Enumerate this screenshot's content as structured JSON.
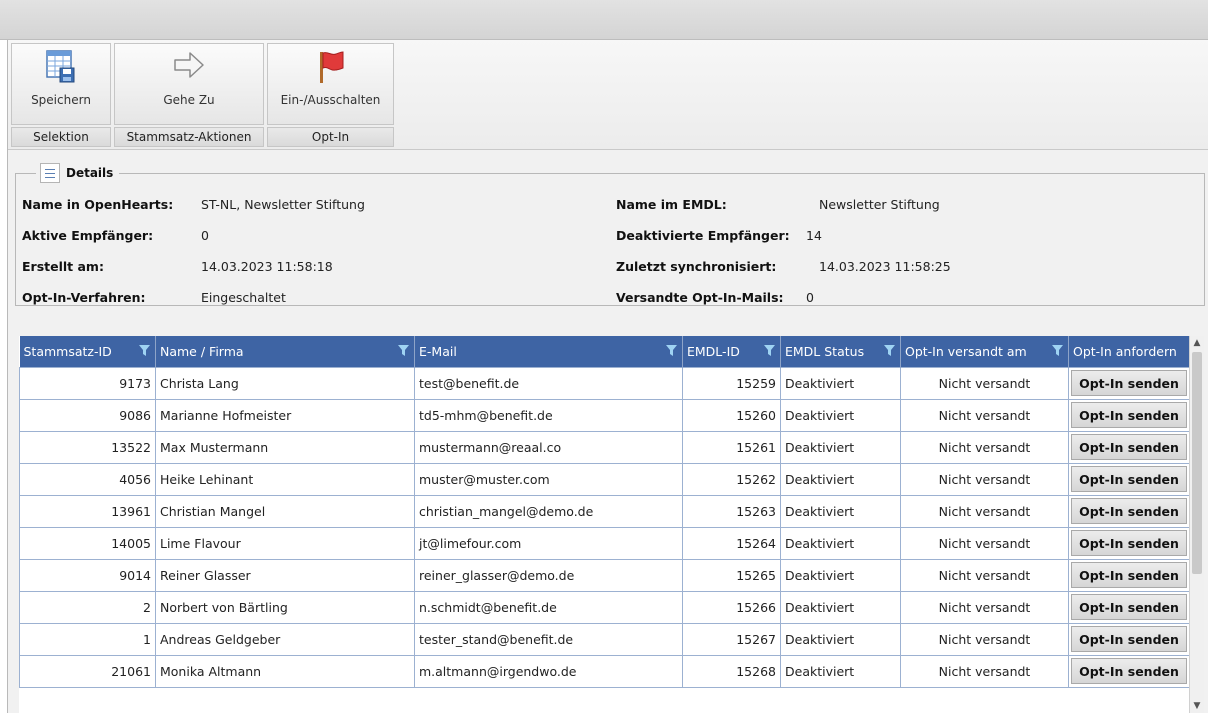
{
  "ribbon": {
    "buttons": [
      {
        "label": "Speichern",
        "icon": "table-save-icon"
      },
      {
        "label": "Gehe Zu",
        "icon": "arrow-right-icon"
      },
      {
        "label": "Ein-/Ausschalten",
        "icon": "red-flag-icon"
      }
    ],
    "groups": [
      "Selektion",
      "Stammsatz-Aktionen",
      "Opt-In"
    ]
  },
  "details": {
    "legend": "Details",
    "left": [
      {
        "label": "Name in OpenHearts:",
        "value": "ST-NL, Newsletter Stiftung"
      },
      {
        "label": "Aktive Empfänger:",
        "value": "0"
      },
      {
        "label": "Erstellt am:",
        "value": "14.03.2023 11:58:18"
      },
      {
        "label": "Opt-In-Verfahren:",
        "value": "Eingeschaltet"
      }
    ],
    "right": [
      {
        "label": "Name im EMDL:",
        "value": "Newsletter Stiftung"
      },
      {
        "label": "Deaktivierte Empfänger:",
        "value": "14"
      },
      {
        "label": "Zuletzt synchronisiert:",
        "value": "14.03.2023 11:58:25"
      },
      {
        "label": "Versandte Opt-In-Mails:",
        "value": "0"
      }
    ]
  },
  "grid": {
    "columns": [
      "Stammsatz-ID",
      "Name / Firma",
      "E-Mail",
      "EMDL-ID",
      "EMDL Status",
      "Opt-In versandt am",
      "Opt-In anfordern"
    ],
    "button_label": "Opt-In senden",
    "rows": [
      {
        "id": "9173",
        "name": "Christa Lang",
        "email": "test@benefit.de",
        "emdl": "15259",
        "status": "Deaktiviert",
        "sent": "Nicht versandt"
      },
      {
        "id": "9086",
        "name": "Marianne Hofmeister",
        "email": "td5-mhm@benefit.de",
        "emdl": "15260",
        "status": "Deaktiviert",
        "sent": "Nicht versandt"
      },
      {
        "id": "13522",
        "name": "Max Mustermann",
        "email": "mustermann@reaal.co",
        "emdl": "15261",
        "status": "Deaktiviert",
        "sent": "Nicht versandt"
      },
      {
        "id": "4056",
        "name": "Heike Lehinant",
        "email": "muster@muster.com",
        "emdl": "15262",
        "status": "Deaktiviert",
        "sent": "Nicht versandt"
      },
      {
        "id": "13961",
        "name": "Christian Mangel",
        "email": "christian_mangel@demo.de",
        "emdl": "15263",
        "status": "Deaktiviert",
        "sent": "Nicht versandt"
      },
      {
        "id": "14005",
        "name": "Lime Flavour",
        "email": "jt@limefour.com",
        "emdl": "15264",
        "status": "Deaktiviert",
        "sent": "Nicht versandt"
      },
      {
        "id": "9014",
        "name": "Reiner Glasser",
        "email": "reiner_glasser@demo.de",
        "emdl": "15265",
        "status": "Deaktiviert",
        "sent": "Nicht versandt"
      },
      {
        "id": "2",
        "name": "Norbert von Bärtling",
        "email": "n.schmidt@benefit.de",
        "emdl": "15266",
        "status": "Deaktiviert",
        "sent": "Nicht versandt"
      },
      {
        "id": "1",
        "name": "Andreas Geldgeber",
        "email": "tester_stand@benefit.de",
        "emdl": "15267",
        "status": "Deaktiviert",
        "sent": "Nicht versandt"
      },
      {
        "id": "21061",
        "name": "Monika Altmann",
        "email": "m.altmann@irgendwo.de",
        "emdl": "15268",
        "status": "Deaktiviert",
        "sent": "Nicht versandt"
      }
    ]
  },
  "colors": {
    "header": "#3e64a4",
    "flag": "#e03a3a"
  }
}
